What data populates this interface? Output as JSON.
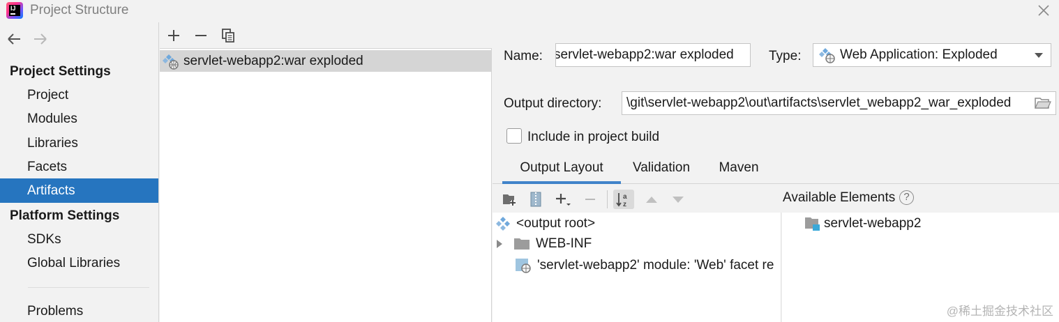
{
  "window": {
    "title": "Project Structure"
  },
  "sidebar": {
    "project_settings_header": "Project Settings",
    "project_items": [
      {
        "label": "Project"
      },
      {
        "label": "Modules"
      },
      {
        "label": "Libraries"
      },
      {
        "label": "Facets"
      },
      {
        "label": "Artifacts",
        "selected": true
      }
    ],
    "platform_settings_header": "Platform Settings",
    "platform_items": [
      {
        "label": "SDKs"
      },
      {
        "label": "Global Libraries"
      }
    ],
    "problems_label": "Problems"
  },
  "artifacts_list": {
    "items": [
      {
        "label": "servlet-webapp2:war exploded",
        "icon": "web-artifact-icon",
        "selected": true
      }
    ]
  },
  "details": {
    "name_label": "Name:",
    "name_value": "servlet-webapp2:war exploded",
    "type_label": "Type:",
    "type_value": "Web Application: Exploded",
    "output_dir_label": "Output directory:",
    "output_dir_value": "\\git\\servlet-webapp2\\out\\artifacts\\servlet_webapp2_war_exploded",
    "include_build_label": "Include in project build",
    "include_build_checked": false
  },
  "tabs": [
    {
      "label": "Output Layout",
      "active": true
    },
    {
      "label": "Validation"
    },
    {
      "label": "Maven"
    }
  ],
  "output_layout": {
    "tree": [
      {
        "label": "<output root>",
        "icon": "output-root-icon"
      },
      {
        "label": "WEB-INF",
        "icon": "folder-icon",
        "expandable": true
      },
      {
        "label": "'servlet-webapp2' module: 'Web' facet re",
        "icon": "web-facet-icon"
      }
    ],
    "available_elements_label": "Available Elements",
    "available_elements": [
      {
        "label": "servlet-webapp2",
        "icon": "module-icon"
      }
    ]
  },
  "watermark": "@稀土掘金技术社区",
  "colors": {
    "selection": "#2675bf",
    "background": "#f2f2f2",
    "panel": "#ffffff",
    "tab_underline": "#4083c9"
  }
}
